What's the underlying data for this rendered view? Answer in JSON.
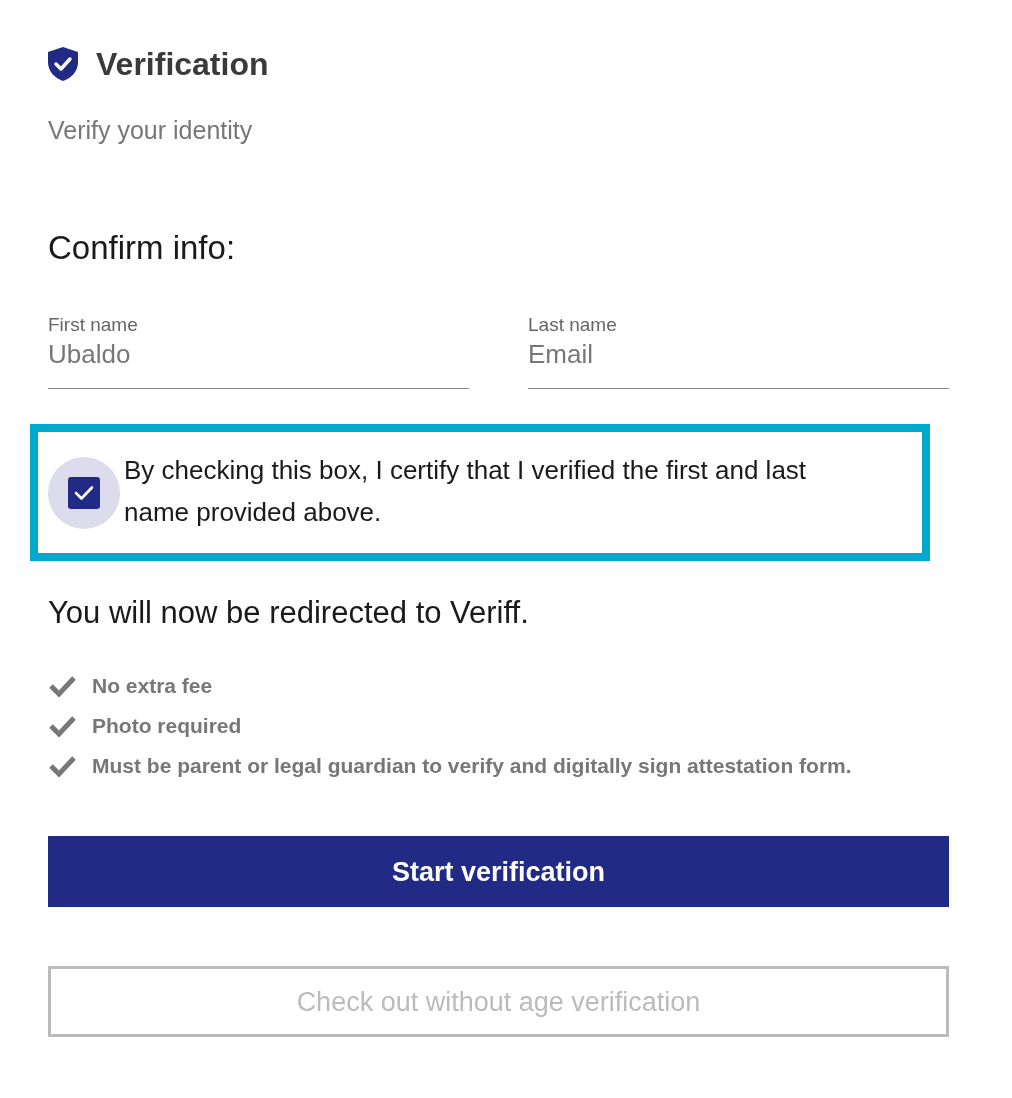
{
  "header": {
    "title": "Verification",
    "subtitle": "Verify your identity"
  },
  "confirm": {
    "heading": "Confirm info:",
    "fields": [
      {
        "label": "First name",
        "value": "Ubaldo"
      },
      {
        "label": "Last name",
        "value": "Email"
      }
    ]
  },
  "consent": {
    "text": "By checking this box, I certify that I verified the first and last name provided above.",
    "checked": true,
    "highlighted": true
  },
  "redirect": {
    "heading": "You will now be redirected to Veriff.",
    "items": [
      "No extra fee",
      "Photo required",
      "Must be parent or legal guardian to verify and digitally sign attestation form."
    ]
  },
  "buttons": [
    {
      "label": "Start verification",
      "kind": "primary",
      "disabled": false
    },
    {
      "label": "Check out without age verification",
      "kind": "outline",
      "disabled": true
    }
  ]
}
